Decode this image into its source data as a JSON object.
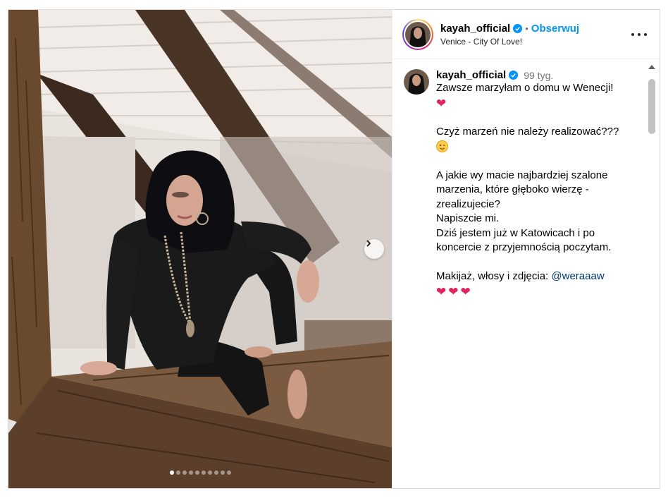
{
  "post": {
    "username": "kayah_official",
    "follow_label": "Obserwuj",
    "separator": "•",
    "location": "Venice - City Of Love!",
    "carousel": {
      "total_images": 10,
      "active_index": 0
    },
    "icons": {
      "verified": "verified-badge-icon",
      "more": "more-options-icon",
      "next": "chevron-right-icon"
    },
    "colors": {
      "follow": "#0095f6",
      "verified": "#0095f6",
      "mention": "#00376b",
      "heart": "#e0245e"
    }
  },
  "caption": {
    "username": "kayah_official",
    "time": "99 tyg.",
    "lines": [
      "Zawsze marzyłam o domu w Wenecji!",
      "Czyż marzeń nie należy realizować???",
      "A jakie wy macie najbardziej szalone",
      "marzenia, które głęboko wierzę -",
      "zrealizujecie?",
      "Napiszcie mi.",
      "Dziś jestem już w Katowicach i po",
      "koncercie z przyjemnością poczytam."
    ],
    "credits_prefix": "Makijaż, włosy i zdjęcia: ",
    "mention": "@weraaaw",
    "emoji_heart": "❤",
    "hearts": "❤❤❤"
  }
}
